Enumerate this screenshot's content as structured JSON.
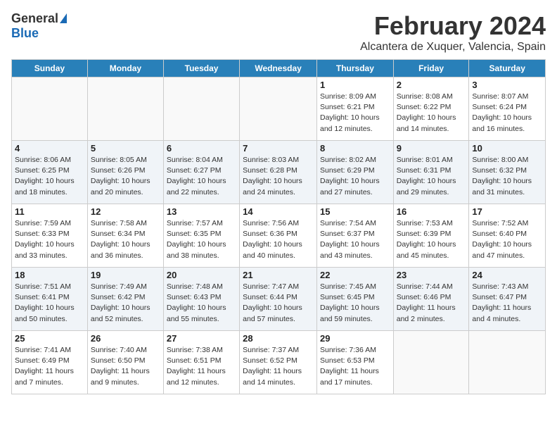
{
  "header": {
    "logo_general": "General",
    "logo_blue": "Blue",
    "month_title": "February 2024",
    "location": "Alcantera de Xuquer, Valencia, Spain"
  },
  "days_of_week": [
    "Sunday",
    "Monday",
    "Tuesday",
    "Wednesday",
    "Thursday",
    "Friday",
    "Saturday"
  ],
  "weeks": [
    [
      {
        "day": "",
        "info": ""
      },
      {
        "day": "",
        "info": ""
      },
      {
        "day": "",
        "info": ""
      },
      {
        "day": "",
        "info": ""
      },
      {
        "day": "1",
        "info": "Sunrise: 8:09 AM\nSunset: 6:21 PM\nDaylight: 10 hours\nand 12 minutes."
      },
      {
        "day": "2",
        "info": "Sunrise: 8:08 AM\nSunset: 6:22 PM\nDaylight: 10 hours\nand 14 minutes."
      },
      {
        "day": "3",
        "info": "Sunrise: 8:07 AM\nSunset: 6:24 PM\nDaylight: 10 hours\nand 16 minutes."
      }
    ],
    [
      {
        "day": "4",
        "info": "Sunrise: 8:06 AM\nSunset: 6:25 PM\nDaylight: 10 hours\nand 18 minutes."
      },
      {
        "day": "5",
        "info": "Sunrise: 8:05 AM\nSunset: 6:26 PM\nDaylight: 10 hours\nand 20 minutes."
      },
      {
        "day": "6",
        "info": "Sunrise: 8:04 AM\nSunset: 6:27 PM\nDaylight: 10 hours\nand 22 minutes."
      },
      {
        "day": "7",
        "info": "Sunrise: 8:03 AM\nSunset: 6:28 PM\nDaylight: 10 hours\nand 24 minutes."
      },
      {
        "day": "8",
        "info": "Sunrise: 8:02 AM\nSunset: 6:29 PM\nDaylight: 10 hours\nand 27 minutes."
      },
      {
        "day": "9",
        "info": "Sunrise: 8:01 AM\nSunset: 6:31 PM\nDaylight: 10 hours\nand 29 minutes."
      },
      {
        "day": "10",
        "info": "Sunrise: 8:00 AM\nSunset: 6:32 PM\nDaylight: 10 hours\nand 31 minutes."
      }
    ],
    [
      {
        "day": "11",
        "info": "Sunrise: 7:59 AM\nSunset: 6:33 PM\nDaylight: 10 hours\nand 33 minutes."
      },
      {
        "day": "12",
        "info": "Sunrise: 7:58 AM\nSunset: 6:34 PM\nDaylight: 10 hours\nand 36 minutes."
      },
      {
        "day": "13",
        "info": "Sunrise: 7:57 AM\nSunset: 6:35 PM\nDaylight: 10 hours\nand 38 minutes."
      },
      {
        "day": "14",
        "info": "Sunrise: 7:56 AM\nSunset: 6:36 PM\nDaylight: 10 hours\nand 40 minutes."
      },
      {
        "day": "15",
        "info": "Sunrise: 7:54 AM\nSunset: 6:37 PM\nDaylight: 10 hours\nand 43 minutes."
      },
      {
        "day": "16",
        "info": "Sunrise: 7:53 AM\nSunset: 6:39 PM\nDaylight: 10 hours\nand 45 minutes."
      },
      {
        "day": "17",
        "info": "Sunrise: 7:52 AM\nSunset: 6:40 PM\nDaylight: 10 hours\nand 47 minutes."
      }
    ],
    [
      {
        "day": "18",
        "info": "Sunrise: 7:51 AM\nSunset: 6:41 PM\nDaylight: 10 hours\nand 50 minutes."
      },
      {
        "day": "19",
        "info": "Sunrise: 7:49 AM\nSunset: 6:42 PM\nDaylight: 10 hours\nand 52 minutes."
      },
      {
        "day": "20",
        "info": "Sunrise: 7:48 AM\nSunset: 6:43 PM\nDaylight: 10 hours\nand 55 minutes."
      },
      {
        "day": "21",
        "info": "Sunrise: 7:47 AM\nSunset: 6:44 PM\nDaylight: 10 hours\nand 57 minutes."
      },
      {
        "day": "22",
        "info": "Sunrise: 7:45 AM\nSunset: 6:45 PM\nDaylight: 10 hours\nand 59 minutes."
      },
      {
        "day": "23",
        "info": "Sunrise: 7:44 AM\nSunset: 6:46 PM\nDaylight: 11 hours\nand 2 minutes."
      },
      {
        "day": "24",
        "info": "Sunrise: 7:43 AM\nSunset: 6:47 PM\nDaylight: 11 hours\nand 4 minutes."
      }
    ],
    [
      {
        "day": "25",
        "info": "Sunrise: 7:41 AM\nSunset: 6:49 PM\nDaylight: 11 hours\nand 7 minutes."
      },
      {
        "day": "26",
        "info": "Sunrise: 7:40 AM\nSunset: 6:50 PM\nDaylight: 11 hours\nand 9 minutes."
      },
      {
        "day": "27",
        "info": "Sunrise: 7:38 AM\nSunset: 6:51 PM\nDaylight: 11 hours\nand 12 minutes."
      },
      {
        "day": "28",
        "info": "Sunrise: 7:37 AM\nSunset: 6:52 PM\nDaylight: 11 hours\nand 14 minutes."
      },
      {
        "day": "29",
        "info": "Sunrise: 7:36 AM\nSunset: 6:53 PM\nDaylight: 11 hours\nand 17 minutes."
      },
      {
        "day": "",
        "info": ""
      },
      {
        "day": "",
        "info": ""
      }
    ]
  ]
}
